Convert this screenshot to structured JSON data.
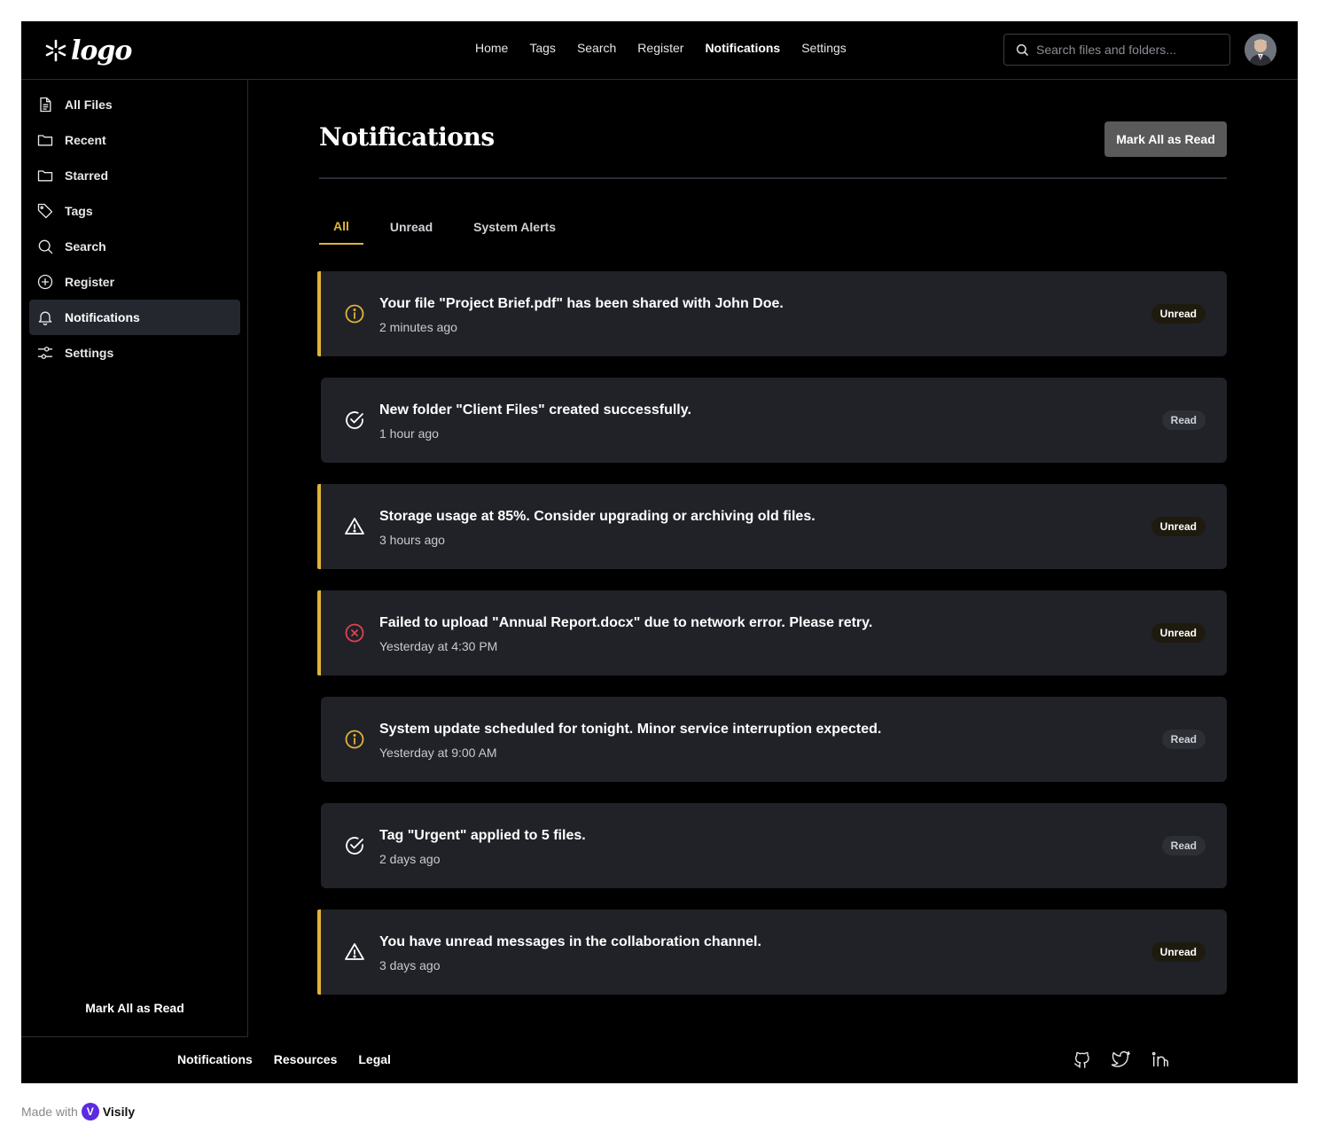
{
  "app": {
    "logo_text": "logo"
  },
  "topnav": {
    "items": [
      {
        "label": "Home",
        "active": false
      },
      {
        "label": "Tags",
        "active": false
      },
      {
        "label": "Search",
        "active": false
      },
      {
        "label": "Register",
        "active": false
      },
      {
        "label": "Notifications",
        "active": true
      },
      {
        "label": "Settings",
        "active": false
      }
    ],
    "search_placeholder": "Search files and folders..."
  },
  "sidebar": {
    "items": [
      {
        "label": "All Files",
        "icon": "file-icon"
      },
      {
        "label": "Recent",
        "icon": "folder-icon"
      },
      {
        "label": "Starred",
        "icon": "folder-icon"
      },
      {
        "label": "Tags",
        "icon": "tag-icon"
      },
      {
        "label": "Search",
        "icon": "search-icon"
      },
      {
        "label": "Register",
        "icon": "plus-circle-icon"
      },
      {
        "label": "Notifications",
        "icon": "bell-icon"
      },
      {
        "label": "Settings",
        "icon": "sliders-icon"
      }
    ],
    "footer_label": "Mark All as Read"
  },
  "main": {
    "title": "Notifications",
    "mark_all_label": "Mark All as Read",
    "tabs": [
      {
        "label": "All",
        "active": true
      },
      {
        "label": "Unread",
        "active": false
      },
      {
        "label": "System Alerts",
        "active": false
      }
    ],
    "notifications": [
      {
        "message": "Your file \"Project Brief.pdf\" has been shared with John Doe.",
        "time": "2 minutes ago",
        "status": "Unread",
        "icon": "info-icon"
      },
      {
        "message": "New folder \"Client Files\" created successfully.",
        "time": "1 hour ago",
        "status": "Read",
        "icon": "check-circle-icon"
      },
      {
        "message": "Storage usage at 85%. Consider upgrading or archiving old files.",
        "time": "3 hours ago",
        "status": "Unread",
        "icon": "warning-icon"
      },
      {
        "message": "Failed to upload \"Annual Report.docx\" due to network error. Please retry.",
        "time": "Yesterday at 4:30 PM",
        "status": "Unread",
        "icon": "error-icon"
      },
      {
        "message": "System update scheduled for tonight. Minor service interruption expected.",
        "time": "Yesterday at 9:00 AM",
        "status": "Read",
        "icon": "info-icon"
      },
      {
        "message": "Tag \"Urgent\" applied to 5 files.",
        "time": "2 days ago",
        "status": "Read",
        "icon": "check-circle-icon"
      },
      {
        "message": "You have unread messages in the collaboration channel.",
        "time": "3 days ago",
        "status": "Unread",
        "icon": "warning-icon"
      }
    ]
  },
  "footer": {
    "links": [
      "Notifications",
      "Resources",
      "Legal"
    ],
    "social": [
      "github-icon",
      "twitter-icon",
      "linkedin-icon"
    ]
  },
  "watermark": {
    "prefix": "Made with",
    "brand": "Visily"
  },
  "colors": {
    "accent": "#e0b43a",
    "error": "#e0424e",
    "card_bg": "#202228",
    "page_bg": "#000000"
  }
}
